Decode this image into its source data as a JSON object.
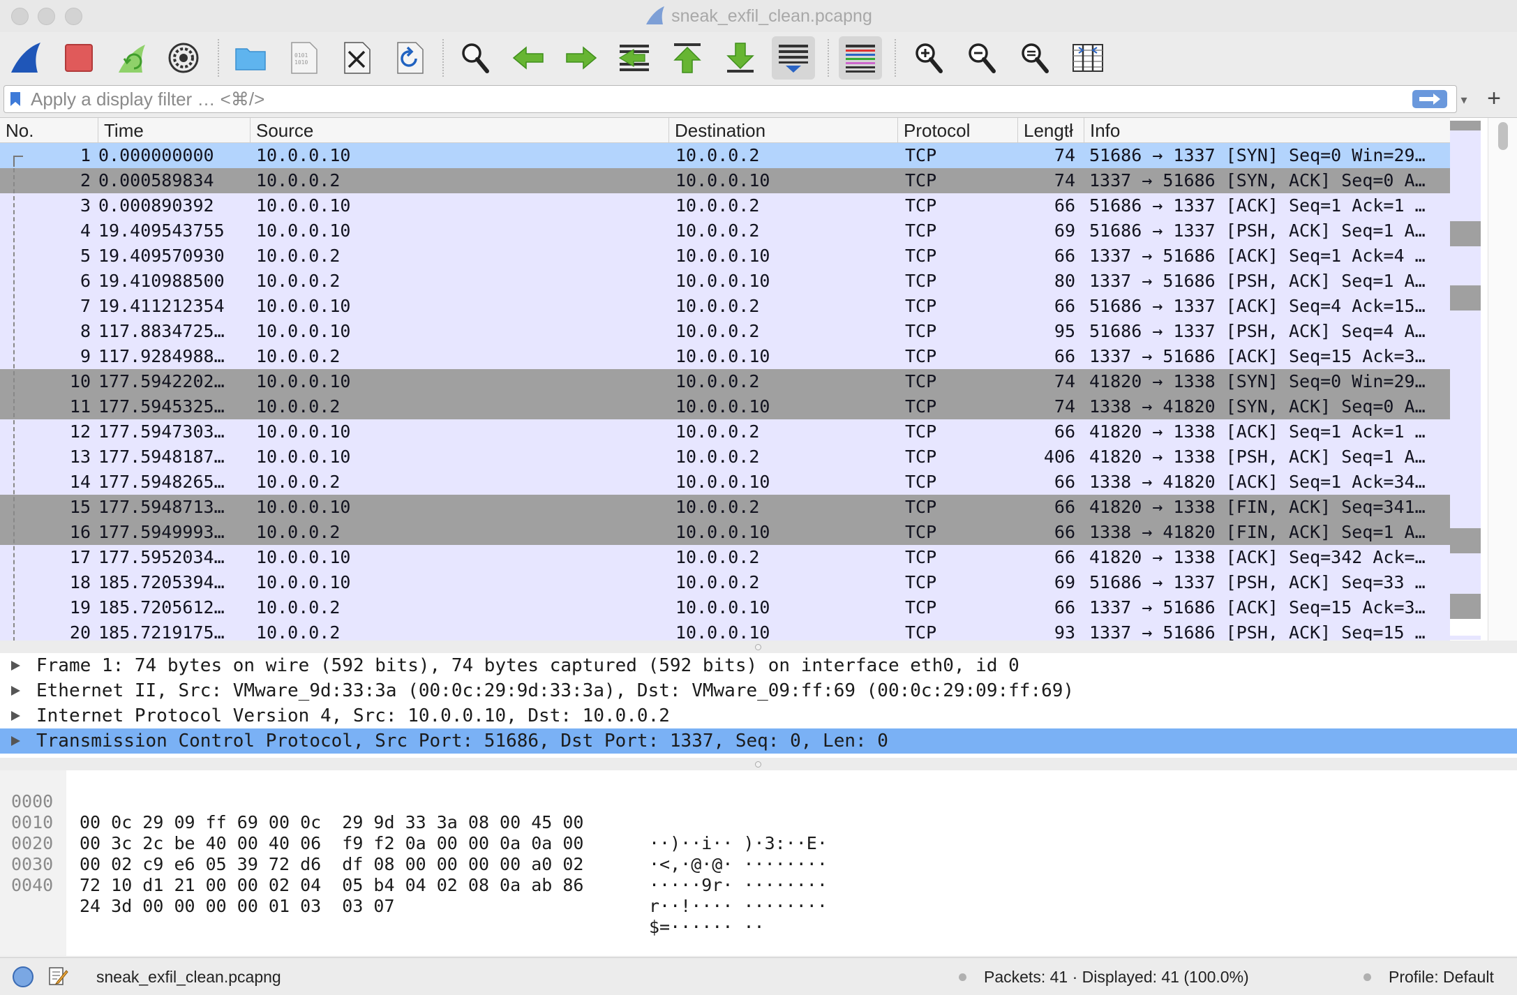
{
  "window": {
    "title": "sneak_exfil_clean.pcapng"
  },
  "toolbar": {
    "buttons": [
      {
        "name": "start-capture",
        "icon": "shark-fin-icon"
      },
      {
        "name": "stop-capture",
        "icon": "stop-square-icon"
      },
      {
        "name": "restart-capture",
        "icon": "restart-fin-icon"
      },
      {
        "name": "capture-options",
        "icon": "gear-icon"
      },
      {
        "name": "open-file",
        "icon": "folder-icon"
      },
      {
        "name": "save-file",
        "icon": "binary-file-icon"
      },
      {
        "name": "close-file",
        "icon": "close-file-icon"
      },
      {
        "name": "reload-file",
        "icon": "reload-file-icon"
      },
      {
        "name": "find-packet",
        "icon": "magnifier-icon"
      },
      {
        "name": "go-back",
        "icon": "arrow-left-icon"
      },
      {
        "name": "go-forward",
        "icon": "arrow-right-icon"
      },
      {
        "name": "go-to-packet",
        "icon": "jump-to-packet-icon"
      },
      {
        "name": "go-first-packet",
        "icon": "arrow-up-bar-icon"
      },
      {
        "name": "go-last-packet",
        "icon": "arrow-down-bar-icon"
      },
      {
        "name": "auto-scroll",
        "icon": "autoscroll-icon"
      },
      {
        "name": "colorize",
        "icon": "colorize-lines-icon"
      },
      {
        "name": "zoom-in",
        "icon": "zoom-in-icon"
      },
      {
        "name": "zoom-out",
        "icon": "zoom-out-icon"
      },
      {
        "name": "normal-size",
        "icon": "zoom-normal-icon"
      },
      {
        "name": "resize-columns",
        "icon": "resize-columns-icon"
      }
    ]
  },
  "filter": {
    "placeholder": "Apply a display filter … <⌘/>",
    "value": ""
  },
  "packet_list": {
    "columns": [
      "No.",
      "Time",
      "Source",
      "Destination",
      "Protocol",
      "Length",
      "Info"
    ],
    "header_labels": {
      "no": "No.",
      "time": "Time",
      "source": "Source",
      "destination": "Destination",
      "protocol": "Protocol",
      "length": "Lengtł",
      "info": "Info"
    },
    "rows": [
      {
        "no": "1",
        "time": "0.000000000",
        "src": "10.0.0.10",
        "dst": "10.0.0.2",
        "proto": "TCP",
        "len": "74",
        "info": "51686 → 1337 [SYN] Seq=0 Win=29…",
        "style": "selected"
      },
      {
        "no": "2",
        "time": "0.000589834",
        "src": "10.0.0.2",
        "dst": "10.0.0.10",
        "proto": "TCP",
        "len": "74",
        "info": "1337 → 51686 [SYN, ACK] Seq=0 A…",
        "style": "gray"
      },
      {
        "no": "3",
        "time": "0.000890392",
        "src": "10.0.0.10",
        "dst": "10.0.0.2",
        "proto": "TCP",
        "len": "66",
        "info": "51686 → 1337 [ACK] Seq=1 Ack=1 …",
        "style": "normal"
      },
      {
        "no": "4",
        "time": "19.409543755",
        "src": "10.0.0.10",
        "dst": "10.0.0.2",
        "proto": "TCP",
        "len": "69",
        "info": "51686 → 1337 [PSH, ACK] Seq=1 A…",
        "style": "normal"
      },
      {
        "no": "5",
        "time": "19.409570930",
        "src": "10.0.0.2",
        "dst": "10.0.0.10",
        "proto": "TCP",
        "len": "66",
        "info": "1337 → 51686 [ACK] Seq=1 Ack=4 …",
        "style": "normal"
      },
      {
        "no": "6",
        "time": "19.410988500",
        "src": "10.0.0.2",
        "dst": "10.0.0.10",
        "proto": "TCP",
        "len": "80",
        "info": "1337 → 51686 [PSH, ACK] Seq=1 A…",
        "style": "normal"
      },
      {
        "no": "7",
        "time": "19.411212354",
        "src": "10.0.0.10",
        "dst": "10.0.0.2",
        "proto": "TCP",
        "len": "66",
        "info": "51686 → 1337 [ACK] Seq=4 Ack=15…",
        "style": "normal"
      },
      {
        "no": "8",
        "time": "117.8834725…",
        "src": "10.0.0.10",
        "dst": "10.0.0.2",
        "proto": "TCP",
        "len": "95",
        "info": "51686 → 1337 [PSH, ACK] Seq=4 A…",
        "style": "normal"
      },
      {
        "no": "9",
        "time": "117.9284988…",
        "src": "10.0.0.2",
        "dst": "10.0.0.10",
        "proto": "TCP",
        "len": "66",
        "info": "1337 → 51686 [ACK] Seq=15 Ack=3…",
        "style": "normal"
      },
      {
        "no": "10",
        "time": "177.5942202…",
        "src": "10.0.0.10",
        "dst": "10.0.0.2",
        "proto": "TCP",
        "len": "74",
        "info": "41820 → 1338 [SYN] Seq=0 Win=29…",
        "style": "gray"
      },
      {
        "no": "11",
        "time": "177.5945325…",
        "src": "10.0.0.2",
        "dst": "10.0.0.10",
        "proto": "TCP",
        "len": "74",
        "info": "1338 → 41820 [SYN, ACK] Seq=0 A…",
        "style": "gray"
      },
      {
        "no": "12",
        "time": "177.5947303…",
        "src": "10.0.0.10",
        "dst": "10.0.0.2",
        "proto": "TCP",
        "len": "66",
        "info": "41820 → 1338 [ACK] Seq=1 Ack=1 …",
        "style": "normal"
      },
      {
        "no": "13",
        "time": "177.5948187…",
        "src": "10.0.0.10",
        "dst": "10.0.0.2",
        "proto": "TCP",
        "len": "406",
        "info": "41820 → 1338 [PSH, ACK] Seq=1 A…",
        "style": "normal"
      },
      {
        "no": "14",
        "time": "177.5948265…",
        "src": "10.0.0.2",
        "dst": "10.0.0.10",
        "proto": "TCP",
        "len": "66",
        "info": "1338 → 41820 [ACK] Seq=1 Ack=34…",
        "style": "normal"
      },
      {
        "no": "15",
        "time": "177.5948713…",
        "src": "10.0.0.10",
        "dst": "10.0.0.2",
        "proto": "TCP",
        "len": "66",
        "info": "41820 → 1338 [FIN, ACK] Seq=341…",
        "style": "gray"
      },
      {
        "no": "16",
        "time": "177.5949993…",
        "src": "10.0.0.2",
        "dst": "10.0.0.10",
        "proto": "TCP",
        "len": "66",
        "info": "1338 → 41820 [FIN, ACK] Seq=1 A…",
        "style": "gray"
      },
      {
        "no": "17",
        "time": "177.5952034…",
        "src": "10.0.0.10",
        "dst": "10.0.0.2",
        "proto": "TCP",
        "len": "66",
        "info": "41820 → 1338 [ACK] Seq=342 Ack=…",
        "style": "normal"
      },
      {
        "no": "18",
        "time": "185.7205394…",
        "src": "10.0.0.10",
        "dst": "10.0.0.2",
        "proto": "TCP",
        "len": "69",
        "info": "51686 → 1337 [PSH, ACK] Seq=33 …",
        "style": "normal"
      },
      {
        "no": "19",
        "time": "185.7205612…",
        "src": "10.0.0.2",
        "dst": "10.0.0.10",
        "proto": "TCP",
        "len": "66",
        "info": "1337 → 51686 [ACK] Seq=15 Ack=3…",
        "style": "normal"
      },
      {
        "no": "20",
        "time": "185.7219175…",
        "src": "10.0.0.2",
        "dst": "10.0.0.10",
        "proto": "TCP",
        "len": "93",
        "info": "1337 → 51686 [PSH, ACK] Seq=15 …",
        "style": "normal"
      }
    ]
  },
  "details": {
    "items": [
      {
        "text": "Frame 1: 74 bytes on wire (592 bits), 74 bytes captured (592 bits) on interface eth0, id 0",
        "expanded": false,
        "selected": false
      },
      {
        "text": "Ethernet II, Src: VMware_9d:33:3a (00:0c:29:9d:33:3a), Dst: VMware_09:ff:69 (00:0c:29:09:ff:69)",
        "expanded": false,
        "selected": false
      },
      {
        "text": "Internet Protocol Version 4, Src: 10.0.0.10, Dst: 10.0.0.2",
        "expanded": false,
        "selected": false
      },
      {
        "text": "Transmission Control Protocol, Src Port: 51686, Dst Port: 1337, Seq: 0, Len: 0",
        "expanded": false,
        "selected": true
      }
    ]
  },
  "bytes": {
    "rows": [
      {
        "offset": "0000",
        "hex": "00 0c 29 09 ff 69 00 0c  29 9d 33 3a 08 00 45 00",
        "ascii": "··)··i·· )·3:··E·"
      },
      {
        "offset": "0010",
        "hex": "00 3c 2c be 40 00 40 06  f9 f2 0a 00 00 0a 0a 00",
        "ascii": "·<,·@·@· ········"
      },
      {
        "offset": "0020",
        "hex": "00 02 c9 e6 05 39 72 d6  df 08 00 00 00 00 a0 02",
        "ascii": "·····9r· ········"
      },
      {
        "offset": "0030",
        "hex": "72 10 d1 21 00 00 02 04  05 b4 04 02 08 0a ab 86",
        "ascii": "r··!···· ········"
      },
      {
        "offset": "0040",
        "hex": "24 3d 00 00 00 00 01 03  03 07",
        "ascii": "$=······ ··"
      }
    ]
  },
  "status": {
    "file": "sneak_exfil_clean.pcapng",
    "packets": "Packets: 41 · Displayed: 41 (100.0%)",
    "profile": "Profile: Default"
  },
  "colors": {
    "selected_row": "#b3d4fd",
    "tcp_row": "#e7e6ff",
    "syn_fin_row": "#a0a0a0",
    "detail_selected": "#7ab1f5",
    "apply_button": "#6a98dc"
  }
}
